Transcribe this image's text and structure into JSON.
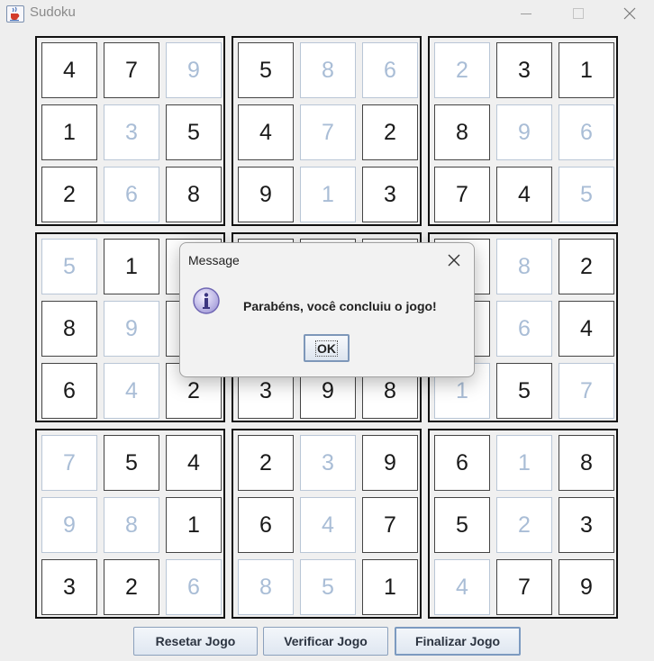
{
  "window": {
    "title": "Sudoku",
    "icon": "java-cup-icon",
    "controls": [
      "minimize-icon",
      "maximize-icon",
      "close-icon"
    ]
  },
  "board": {
    "boxes": [
      [
        {
          "v": "4",
          "g": true
        },
        {
          "v": "7",
          "g": true
        },
        {
          "v": "9",
          "g": false
        },
        {
          "v": "1",
          "g": true
        },
        {
          "v": "3",
          "g": false
        },
        {
          "v": "5",
          "g": true
        },
        {
          "v": "2",
          "g": true
        },
        {
          "v": "6",
          "g": false
        },
        {
          "v": "8",
          "g": true
        }
      ],
      [
        {
          "v": "5",
          "g": true
        },
        {
          "v": "8",
          "g": false
        },
        {
          "v": "6",
          "g": false
        },
        {
          "v": "4",
          "g": true
        },
        {
          "v": "7",
          "g": false
        },
        {
          "v": "2",
          "g": true
        },
        {
          "v": "9",
          "g": true
        },
        {
          "v": "1",
          "g": false
        },
        {
          "v": "3",
          "g": true
        }
      ],
      [
        {
          "v": "2",
          "g": false
        },
        {
          "v": "3",
          "g": true
        },
        {
          "v": "1",
          "g": true
        },
        {
          "v": "8",
          "g": true
        },
        {
          "v": "9",
          "g": false
        },
        {
          "v": "6",
          "g": false
        },
        {
          "v": "7",
          "g": true
        },
        {
          "v": "4",
          "g": true
        },
        {
          "v": "5",
          "g": false
        }
      ],
      [
        {
          "v": "5",
          "g": false
        },
        {
          "v": "1",
          "g": true
        },
        {
          "v": "",
          "g": true
        },
        {
          "v": "8",
          "g": true
        },
        {
          "v": "9",
          "g": false
        },
        {
          "v": "",
          "g": true
        },
        {
          "v": "6",
          "g": true
        },
        {
          "v": "4",
          "g": false
        },
        {
          "v": "2",
          "g": true
        }
      ],
      [
        {
          "v": "",
          "g": true
        },
        {
          "v": "",
          "g": true
        },
        {
          "v": "",
          "g": true
        },
        {
          "v": "",
          "g": true
        },
        {
          "v": "",
          "g": true
        },
        {
          "v": "",
          "g": true
        },
        {
          "v": "3",
          "g": true
        },
        {
          "v": "9",
          "g": true
        },
        {
          "v": "8",
          "g": true
        }
      ],
      [
        {
          "v": "",
          "g": true
        },
        {
          "v": "8",
          "g": false
        },
        {
          "v": "2",
          "g": true
        },
        {
          "v": "",
          "g": true
        },
        {
          "v": "6",
          "g": false
        },
        {
          "v": "4",
          "g": true
        },
        {
          "v": "1",
          "g": false
        },
        {
          "v": "5",
          "g": true
        },
        {
          "v": "7",
          "g": false
        }
      ],
      [
        {
          "v": "7",
          "g": false
        },
        {
          "v": "5",
          "g": true
        },
        {
          "v": "4",
          "g": true
        },
        {
          "v": "9",
          "g": false
        },
        {
          "v": "8",
          "g": false
        },
        {
          "v": "1",
          "g": true
        },
        {
          "v": "3",
          "g": true
        },
        {
          "v": "2",
          "g": true
        },
        {
          "v": "6",
          "g": false
        }
      ],
      [
        {
          "v": "2",
          "g": true
        },
        {
          "v": "3",
          "g": false
        },
        {
          "v": "9",
          "g": true
        },
        {
          "v": "6",
          "g": true
        },
        {
          "v": "4",
          "g": false
        },
        {
          "v": "7",
          "g": true
        },
        {
          "v": "8",
          "g": false
        },
        {
          "v": "5",
          "g": false
        },
        {
          "v": "1",
          "g": true
        }
      ],
      [
        {
          "v": "6",
          "g": true
        },
        {
          "v": "1",
          "g": false
        },
        {
          "v": "8",
          "g": true
        },
        {
          "v": "5",
          "g": true
        },
        {
          "v": "2",
          "g": false
        },
        {
          "v": "3",
          "g": true
        },
        {
          "v": "4",
          "g": false
        },
        {
          "v": "7",
          "g": true
        },
        {
          "v": "9",
          "g": true
        }
      ]
    ]
  },
  "buttons": {
    "reset": "Resetar Jogo",
    "verify": "Verificar Jogo",
    "finish": "Finalizar Jogo"
  },
  "dialog": {
    "title": "Message",
    "message": "Parabéns, você concluiu o jogo!",
    "ok": "OK",
    "icon": "info-icon"
  },
  "colors": {
    "given_text": "#1a1a1a",
    "user_text": "#a9bdd6",
    "box_border": "#111111",
    "button_border": "#8ba0bc"
  }
}
